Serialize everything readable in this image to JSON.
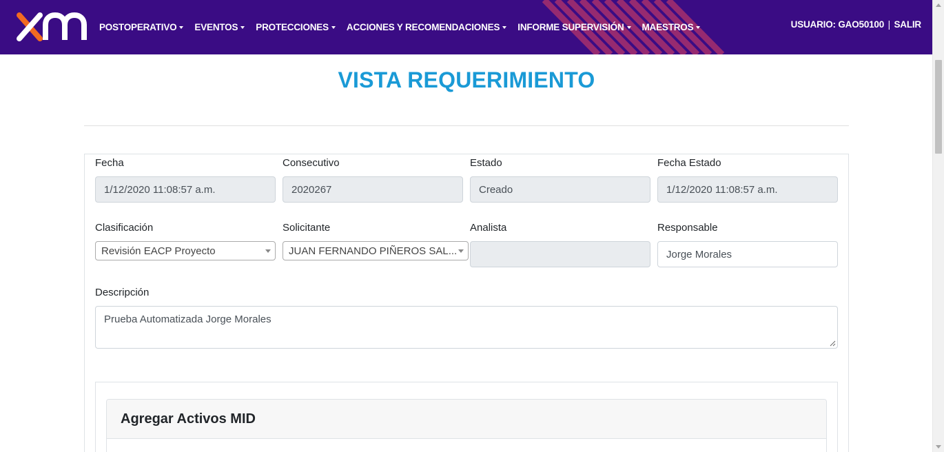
{
  "nav": {
    "logo_text": "xm",
    "menu": [
      {
        "label": "POSTOPERATIVO"
      },
      {
        "label": "EVENTOS"
      },
      {
        "label": "PROTECCIONES"
      },
      {
        "label": "ACCIONES Y RECOMENDACIONES"
      },
      {
        "label": "INFORME SUPERVISIÓN"
      },
      {
        "label": "MAESTROS"
      }
    ],
    "user_label": "USUARIO: GAO50100",
    "separator": "|",
    "logout_label": "SALIR"
  },
  "page": {
    "title": "VISTA REQUERIMIENTO"
  },
  "form": {
    "fecha": {
      "label": "Fecha",
      "value": "1/12/2020 11:08:57 a.m."
    },
    "consecutivo": {
      "label": "Consecutivo",
      "value": "2020267"
    },
    "estado": {
      "label": "Estado",
      "value": "Creado"
    },
    "fecha_estado": {
      "label": "Fecha Estado",
      "value": "1/12/2020 11:08:57 a.m."
    },
    "clasificacion": {
      "label": "Clasificación",
      "value": "Revisión EACP Proyecto"
    },
    "solicitante": {
      "label": "Solicitante",
      "value": "JUAN FERNANDO PIÑEROS SAL..."
    },
    "analista": {
      "label": "Analista",
      "value": ""
    },
    "responsable": {
      "label": "Responsable",
      "value": "Jorge Morales"
    },
    "descripcion": {
      "label": "Descripción",
      "value": "Prueba Automatizada Jorge Morales"
    }
  },
  "panel": {
    "title": "Agregar Activos MID"
  },
  "colors": {
    "navbar": "#3a0c84",
    "title": "#1a9ad6",
    "logo_accent": "#f26a21",
    "stripe": "#b5346a"
  }
}
